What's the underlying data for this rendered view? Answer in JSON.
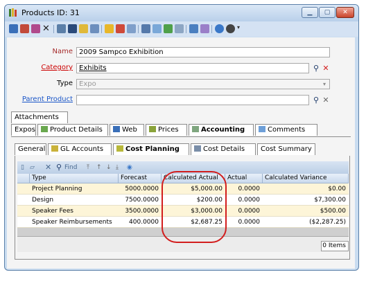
{
  "window": {
    "title": "Products ID: 31"
  },
  "fields": {
    "name_label": "Name",
    "name_value": "2009 Sampco Exhibition",
    "category_label": "Category",
    "category_value": "Exhibits",
    "type_label": "Type",
    "type_value": "Expo",
    "parent_label": "Parent Product",
    "parent_value": ""
  },
  "tabs_row1": {
    "attachments": "Attachments"
  },
  "tabs_row2": {
    "expos": "Expos",
    "product_details": "Product Details",
    "web": "Web",
    "prices": "Prices",
    "accounting": "Accounting",
    "comments": "Comments"
  },
  "tabs_row3": {
    "general": "General",
    "gl_accounts": "GL Accounts",
    "cost_planning": "Cost Planning",
    "cost_details": "Cost Details",
    "cost_summary": "Cost Summary"
  },
  "grid_toolbar": {
    "find_label": "Find"
  },
  "table": {
    "headers": [
      "Type",
      "Forecast",
      "Calculated Actual",
      "Actual",
      "Calculated Variance"
    ],
    "rows": [
      [
        "Project Planning",
        "5000.0000",
        "$5,000.00",
        "0.0000",
        "$0.00"
      ],
      [
        "Design",
        "7500.0000",
        "$200.00",
        "0.0000",
        "$7,300.00"
      ],
      [
        "Speaker Fees",
        "3500.0000",
        "$3,000.00",
        "0.0000",
        "$500.00"
      ],
      [
        "Speaker Reimbursements",
        "400.0000",
        "$2,687.25",
        "0.0000",
        "($2,287.25)"
      ]
    ]
  },
  "footer": {
    "count": "0 Items"
  },
  "colors": {
    "accent": "#d21d1d",
    "selected_tab": "#ffffff"
  }
}
